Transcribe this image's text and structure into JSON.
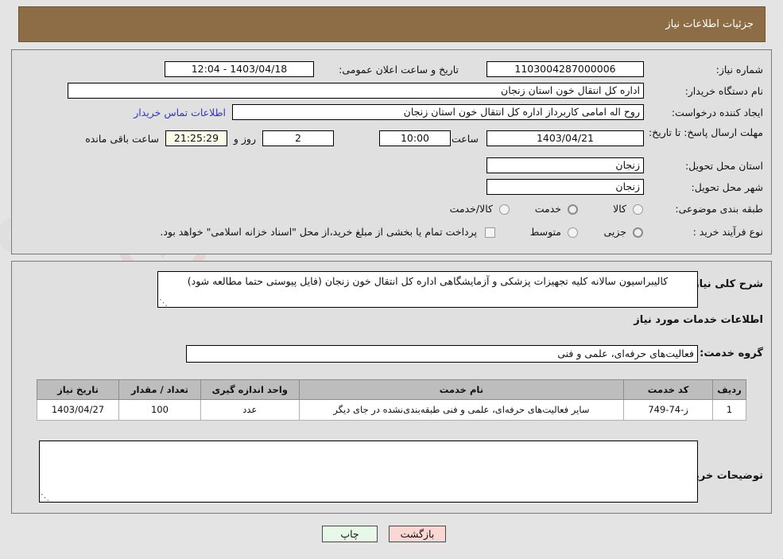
{
  "header": {
    "title": "جزئیات اطلاعات نیاز"
  },
  "top": {
    "need_number_label": "شماره نیاز:",
    "need_number_value": "1103004287000006",
    "announce_label": "تاریخ و ساعت اعلان عمومی:",
    "announce_value": "1403/04/18 - 12:04",
    "buyer_org_label": "نام دستگاه خریدار:",
    "buyer_org_value": "اداره کل انتقال خون استان زنجان",
    "creator_label": "ایجاد کننده درخواست:",
    "creator_value": "روح اله  امامی کاربرداز اداره کل انتقال خون استان زنجان",
    "contact_link": "اطلاعات تماس خریدار",
    "deadline_label": "مهلت ارسال پاسخ: تا تاریخ:",
    "deadline_date": "1403/04/21",
    "hour_label": "ساعت",
    "hour_value": "10:00",
    "days_value": "2",
    "days_text": "روز و",
    "countdown_value": "21:25:29",
    "countdown_text": "ساعت باقی مانده",
    "province_label": "استان محل تحویل:",
    "province_value": "زنجان",
    "city_label": "شهر محل تحویل:",
    "city_value": "زنجان",
    "category_label": "طبقه بندی موضوعی:",
    "category_options": [
      {
        "label": "کالا",
        "selected": false
      },
      {
        "label": "خدمت",
        "selected": true
      },
      {
        "label": "کالا/خدمت",
        "selected": false
      }
    ],
    "process_label": "نوع فرآیند خرید :",
    "process_options": [
      {
        "label": "جزیی",
        "selected": true
      },
      {
        "label": "متوسط",
        "selected": false
      }
    ],
    "treasury_checkbox_text": "پرداخت تمام یا بخشی از مبلغ خرید،از محل \"اسناد خزانه اسلامی\" خواهد بود."
  },
  "bottom": {
    "general_desc_label": "شرح کلی نیاز:",
    "general_desc_value": "کالیبراسیون سالانه کلیه تجهیزات پزشکی و آزمایشگاهی اداره کل انتقال خون زنجان (فایل پیوستی حتما مطالعه شود)",
    "services_heading": "اطلاعات خدمات مورد نیاز",
    "service_group_label": "گروه خدمت:",
    "service_group_value": "فعالیت‌های حرفه‌ای، علمی و فنی",
    "table": {
      "columns": [
        "ردیف",
        "کد خدمت",
        "نام خدمت",
        "واحد اندازه گیری",
        "تعداد / مقدار",
        "تاریخ نیاز"
      ],
      "rows": [
        {
          "row": "1",
          "code": "ز-74-749",
          "name": "سایر فعالیت‌های حرفه‌ای، علمی و فنی طبقه‌بندی‌نشده در جای دیگر",
          "unit": "عدد",
          "qty": "100",
          "date": "1403/04/27"
        }
      ]
    },
    "buyer_notes_label": "توضیحات خریدار:",
    "buyer_notes_value": ""
  },
  "footer": {
    "print_label": "چاپ",
    "back_label": "بازگشت"
  }
}
